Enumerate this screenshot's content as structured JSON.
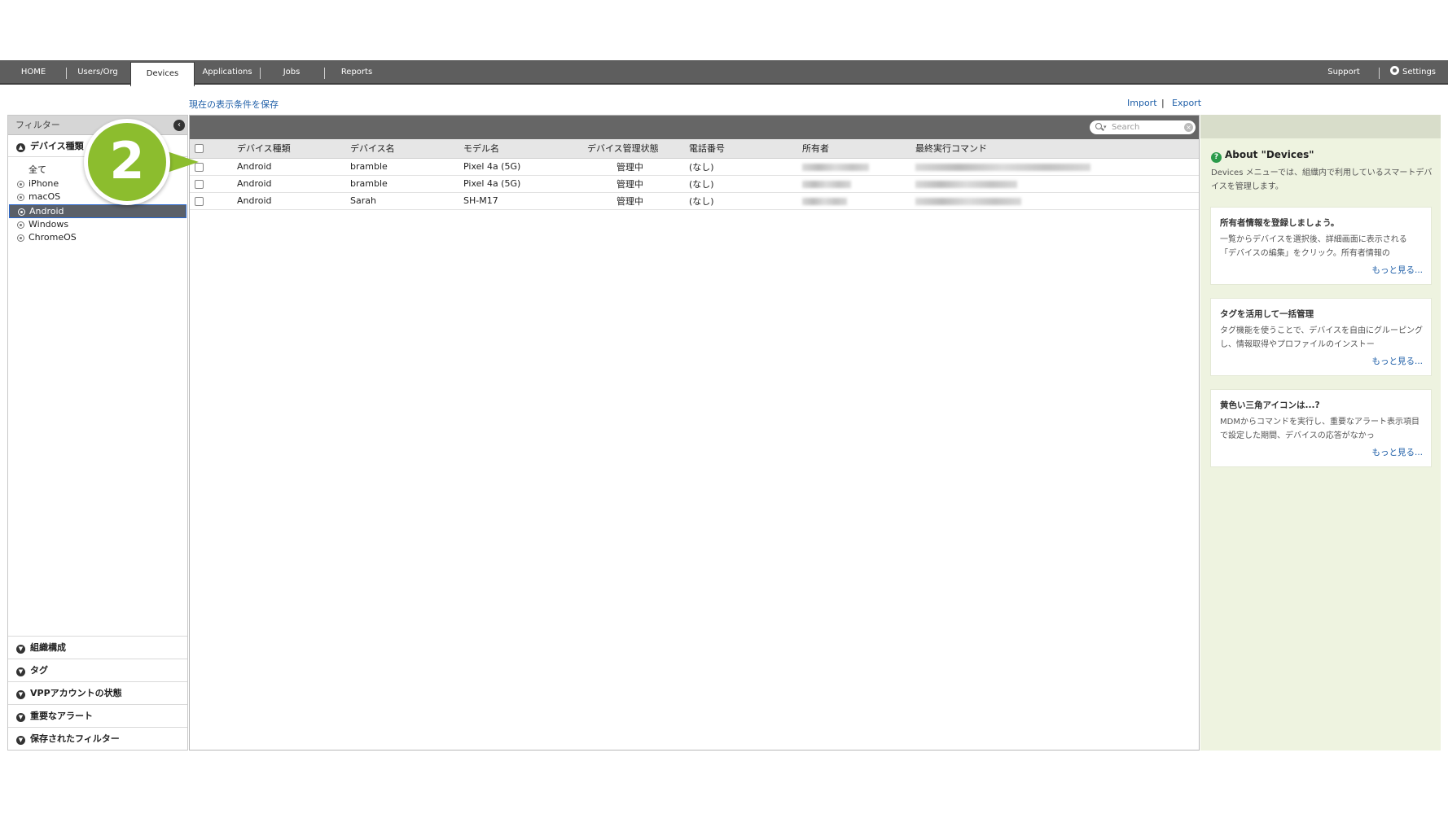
{
  "nav": {
    "tabs": [
      {
        "label": "HOME"
      },
      {
        "label": "Users/Org"
      },
      {
        "label": "Devices"
      },
      {
        "label": "Applications"
      },
      {
        "label": "Jobs"
      },
      {
        "label": "Reports"
      }
    ],
    "support": "Support",
    "settings": "Settings"
  },
  "links": {
    "save_view": "現在の表示条件を保存",
    "import": "Import",
    "separator": "|",
    "export": "Export"
  },
  "filter": {
    "title": "フィルター",
    "device_type_header": "デバイス種類",
    "options": [
      "全て",
      "iPhone",
      "macOS",
      "Android",
      "Windows",
      "ChromeOS"
    ],
    "selected": "Android",
    "sections": [
      "組織構成",
      "タグ",
      "VPPアカウントの状態",
      "重要なアラート",
      "保存されたフィルター"
    ]
  },
  "search": {
    "placeholder": "Search"
  },
  "table": {
    "headers": [
      "デバイス種類",
      "デバイス名",
      "モデル名",
      "デバイス管理状態",
      "電話番号",
      "所有者",
      "最終実行コマンド"
    ],
    "rows": [
      {
        "type": "Android",
        "name": "bramble",
        "model": "Pixel 4a (5G)",
        "status": "管理中",
        "phone": "(なし)"
      },
      {
        "type": "Android",
        "name": "bramble",
        "model": "Pixel 4a (5G)",
        "status": "管理中",
        "phone": "(なし)"
      },
      {
        "type": "Android",
        "name": "Sarah",
        "model": "SH-M17",
        "status": "管理中",
        "phone": "(なし)"
      }
    ]
  },
  "help": {
    "about_title": "About \"Devices\"",
    "about_desc": "Devices メニューでは、組織内で利用しているスマートデバイスを管理します。",
    "cards": [
      {
        "title": "所有者情報を登録しましょう。",
        "body": "一覧からデバイスを選択後、詳細画面に表示される「デバイスの編集」をクリック。所有者情報の",
        "more": "もっと見る..."
      },
      {
        "title": "タグを活用して一括管理",
        "body": "タグ機能を使うことで、デバイスを自由にグルーピングし、情報取得やプロファイルのインストー",
        "more": "もっと見る..."
      },
      {
        "title": "黄色い三角アイコンは...?",
        "body": "MDMからコマンドを実行し、重要なアラート表示項目で設定した期間、デバイスの応答がなかっ",
        "more": "もっと見る..."
      }
    ]
  },
  "callout": {
    "number": "2"
  },
  "colors": {
    "accent": "#8cbd2e",
    "link": "#1f5fa8",
    "nav_bg": "#5e5e5e",
    "help_bg": "#eef3e0"
  }
}
